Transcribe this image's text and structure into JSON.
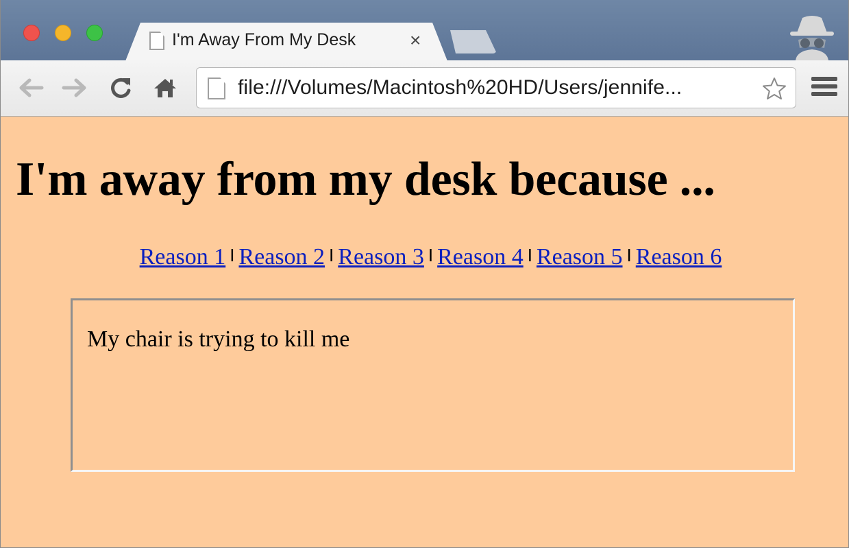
{
  "window": {
    "tab_title": "I'm Away From My Desk",
    "tab_close": "×"
  },
  "toolbar": {
    "url": "file:///Volumes/Macintosh%20HD/Users/jennife..."
  },
  "page": {
    "heading": "I'm away from my desk because ...",
    "links": [
      "Reason 1",
      "Reason 2",
      "Reason 3",
      "Reason 4",
      "Reason 5",
      "Reason 6"
    ],
    "separator": "I",
    "frame_text": "My chair is trying to kill me"
  },
  "colors": {
    "page_background": "#fecb9b",
    "link": "#0b1fbf",
    "tabstrip": "#5d7597"
  },
  "icons": [
    "back-arrow-icon",
    "forward-arrow-icon",
    "reload-icon",
    "home-icon",
    "page-icon",
    "star-icon",
    "menu-icon",
    "incognito-icon"
  ]
}
